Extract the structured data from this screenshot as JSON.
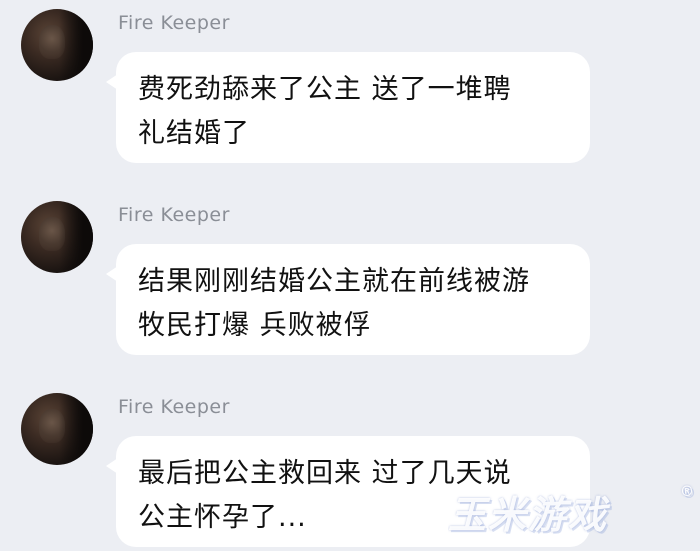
{
  "messages": [
    {
      "sender": "Fire Keeper",
      "lines": [
        "费死劲舔来了公主 送了一堆聘",
        "礼结婚了"
      ]
    },
    {
      "sender": "Fire Keeper",
      "lines": [
        "结果刚刚结婚公主就在前线被游",
        "牧民打爆 兵败被俘"
      ]
    },
    {
      "sender": "Fire Keeper",
      "lines": [
        "最后把公主救回来 过了几天说",
        "公主怀孕了..."
      ]
    }
  ],
  "watermark": {
    "text": "玉米游戏",
    "registered_mark": "®"
  }
}
